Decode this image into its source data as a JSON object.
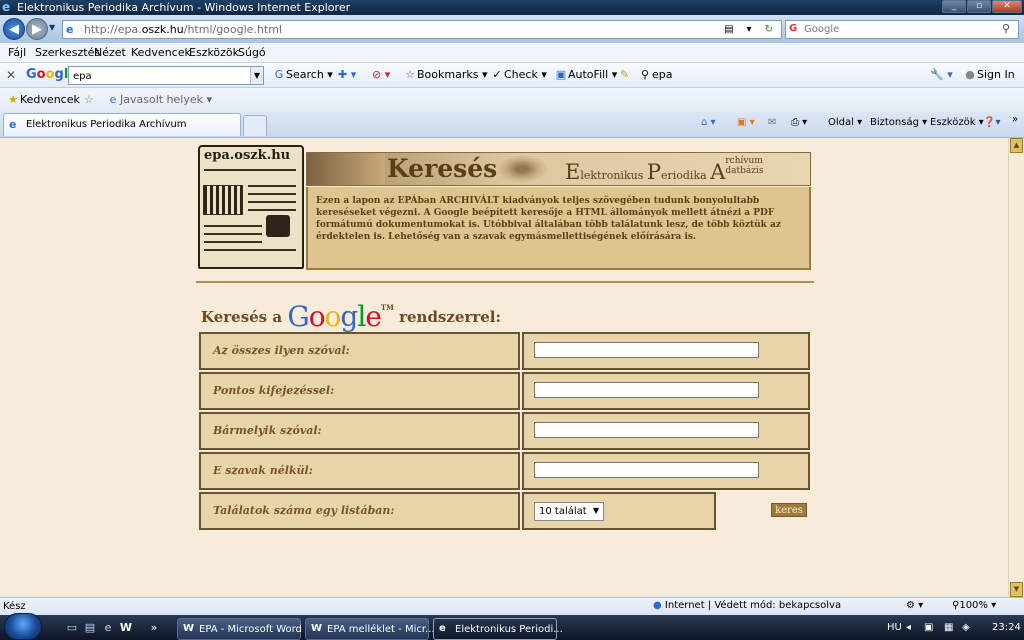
{
  "window": {
    "title": "Elektronikus Periodika Archívum - Windows Internet Explorer"
  },
  "address": {
    "url_prefix": "http://epa.",
    "url_domain": "oszk.hu",
    "url_suffix": "/html/google.html",
    "search_placeholder": "Google"
  },
  "menubar": [
    "Fájl",
    "Szerkesztés",
    "Nézet",
    "Kedvencek",
    "Eszközök",
    "Súgó"
  ],
  "google_toolbar": {
    "logo": "Google",
    "query": "epa",
    "search_label": "Search",
    "bookmarks_label": "Bookmarks",
    "check_label": "Check",
    "autofill_label": "AutoFill",
    "highlight_label": "epa",
    "signin_label": "Sign In"
  },
  "favorites": {
    "favorites_label": "Kedvencek",
    "suggested_label": "Javasolt helyek"
  },
  "tabs": {
    "active_title": "Elektronikus Periodika Archívum"
  },
  "commandbar": {
    "page_label": "Oldal",
    "safety_label": "Biztonság",
    "tools_label": "Eszközök"
  },
  "page": {
    "logo_text": "epa.oszk.hu",
    "banner_title": "Keresés",
    "banner_e": "E",
    "banner_elektronikus": "lektronikus",
    "banner_p": "P",
    "banner_periodika": "eriodika",
    "banner_a": "A",
    "banner_archivum": "rchívum",
    "banner_datbazis": "datbázis",
    "intro": "Ezen a lapon az EPÁban ARCHIVÁLT kiadványok teljes szövegében tudunk bonyolultabb kereséseket végezni. A Google beépített keresője a HTML állományok mellett átnézi a PDF formátumú dokumentumokat is. Utóbbival általában több találatunk lesz, de több köztük az érdektelen is. Lehetőség van a szavak egymásmellettiségének előírására is.",
    "form_title_prefix": "Keresés a",
    "form_title_suffix": "rendszerrel:",
    "google_word": "Google",
    "google_tm": "TM",
    "fields": [
      {
        "label": "Az összes ilyen szóval:",
        "value": ""
      },
      {
        "label": "Pontos kifejezéssel:",
        "value": ""
      },
      {
        "label": "Bármelyik szóval:",
        "value": ""
      },
      {
        "label": "E szavak nélkül:",
        "value": ""
      }
    ],
    "results_label": "Találatok száma egy listában:",
    "results_value": "10 találat",
    "submit_label": "keres"
  },
  "status": {
    "left": "Kész",
    "zone": "Internet | Védett mód: bekapcsolva",
    "zoom": "100%"
  },
  "taskbar": {
    "tasks": [
      {
        "label": "EPA - Microsoft Word",
        "icon": "W"
      },
      {
        "label": "EPA melléklet - Micr...",
        "icon": "W"
      },
      {
        "label": "Elektronikus Periodi...",
        "icon": "e"
      }
    ],
    "lang": "HU",
    "time": "23:24"
  }
}
